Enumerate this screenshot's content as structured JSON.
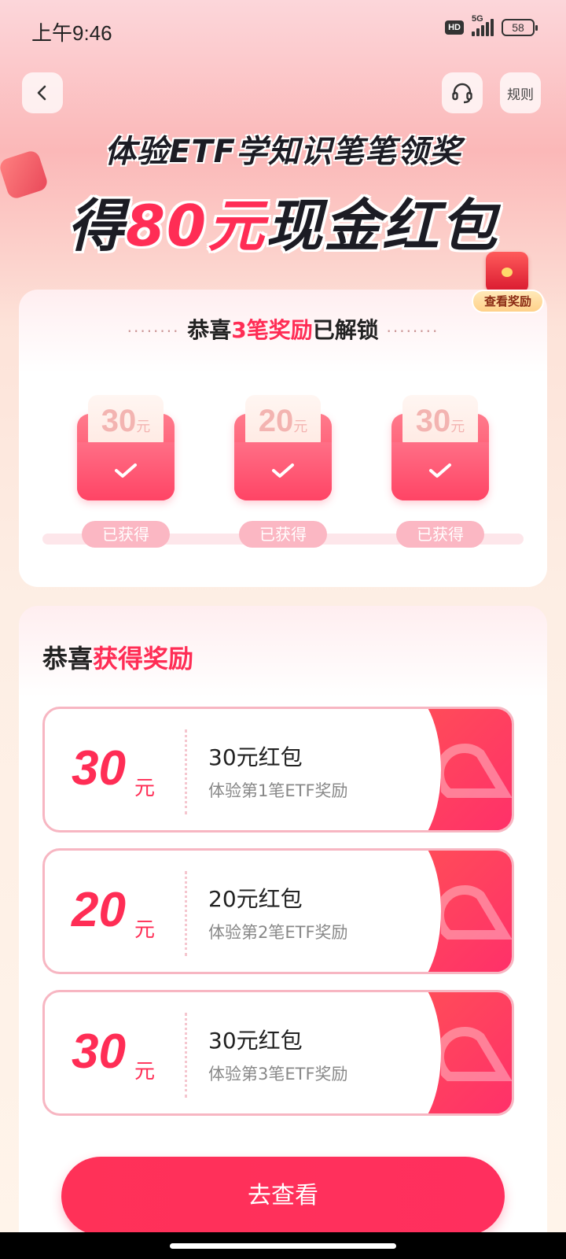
{
  "status_bar": {
    "time": "上午9:46",
    "hd": "HD",
    "network": "5G",
    "battery": "58"
  },
  "nav": {
    "back_icon": "chevron-left-icon",
    "service_icon": "headset-icon",
    "rules_label": "规则"
  },
  "hero": {
    "line1": "体验ETF学知识笔笔领奖",
    "line2_prefix": "得",
    "line2_amount": "80元",
    "line2_suffix": "现金红包"
  },
  "view_rewards_label": "查看奖励",
  "unlock_card": {
    "title_prefix": "恭喜",
    "title_highlight": "3笔奖励",
    "title_suffix": "已解锁",
    "rewards": [
      {
        "amount": "30",
        "unit": "元",
        "status": "已获得"
      },
      {
        "amount": "20",
        "unit": "元",
        "status": "已获得"
      },
      {
        "amount": "30",
        "unit": "元",
        "status": "已获得"
      }
    ]
  },
  "earned_card": {
    "title_prefix": "恭喜",
    "title_highlight": "获得奖励",
    "coupons": [
      {
        "amount": "30",
        "unit": "元",
        "title": "30元红包",
        "subtitle": "体验第1笔ETF奖励"
      },
      {
        "amount": "20",
        "unit": "元",
        "title": "20元红包",
        "subtitle": "体验第2笔ETF奖励"
      },
      {
        "amount": "30",
        "unit": "元",
        "title": "30元红包",
        "subtitle": "体验第3笔ETF奖励"
      }
    ]
  },
  "cta_label": "去查看",
  "colors": {
    "accent": "#ff2d55",
    "reward_tag": "#fbb7c3"
  }
}
